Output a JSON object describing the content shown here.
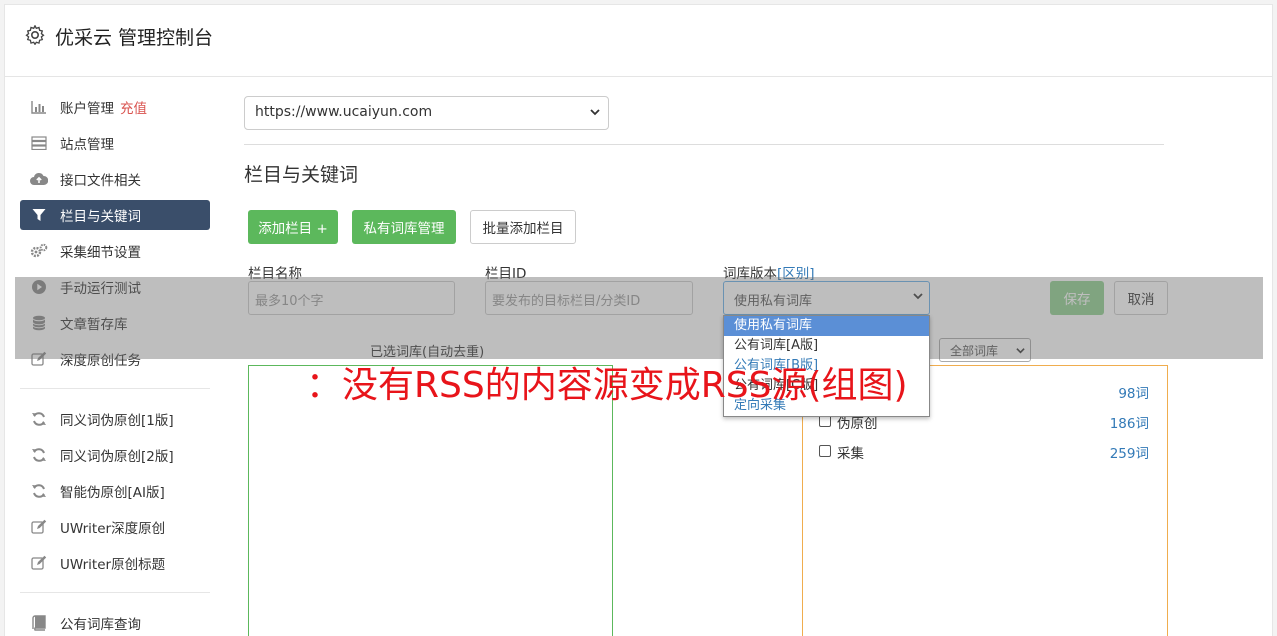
{
  "header": {
    "title": "优采云 管理控制台"
  },
  "sidebar": {
    "items": [
      {
        "label": "账户管理",
        "badge": "充值"
      },
      {
        "label": "站点管理"
      },
      {
        "label": "接口文件相关"
      },
      {
        "label": "栏目与关键词"
      },
      {
        "label": "采集细节设置"
      },
      {
        "label": "手动运行测试"
      },
      {
        "label": "文章暂存库"
      },
      {
        "label": "深度原创任务"
      },
      {
        "label": "同义词伪原创[1版]"
      },
      {
        "label": "同义词伪原创[2版]"
      },
      {
        "label": "智能伪原创[AI版]"
      },
      {
        "label": "UWriter深度原创"
      },
      {
        "label": "UWriter原创标题"
      },
      {
        "label": "公有词库查询"
      }
    ]
  },
  "main": {
    "site_select": "https://www.ucaiyun.com",
    "section_title": "栏目与关键词",
    "buttons": {
      "add_column": "添加栏目 +",
      "private_lib": "私有词库管理",
      "batch_add": "批量添加栏目",
      "save": "保存",
      "cancel": "取消"
    },
    "form": {
      "name_label": "栏目名称",
      "name_placeholder": "最多10个字",
      "id_label": "栏目ID",
      "id_placeholder": "要发布的目标栏目/分类ID",
      "lib_label": "词库版本",
      "lib_diff_link": "[区别]",
      "lib_value": "使用私有词库"
    },
    "dropdown_options": [
      "使用私有词库",
      "公有词库[A版]",
      "公有词库[B版]",
      "公有词库[C版]",
      "定向采集"
    ],
    "selected_panel_title": "已选词库(自动去重)",
    "filter_select": "全部词库",
    "libraries": [
      {
        "name": "",
        "count": "98词"
      },
      {
        "name": "伪原创",
        "count": "186词"
      },
      {
        "name": "采集",
        "count": "259词"
      }
    ]
  },
  "watermark": "：没有RSS的内容源变成RSS源(组图)"
}
